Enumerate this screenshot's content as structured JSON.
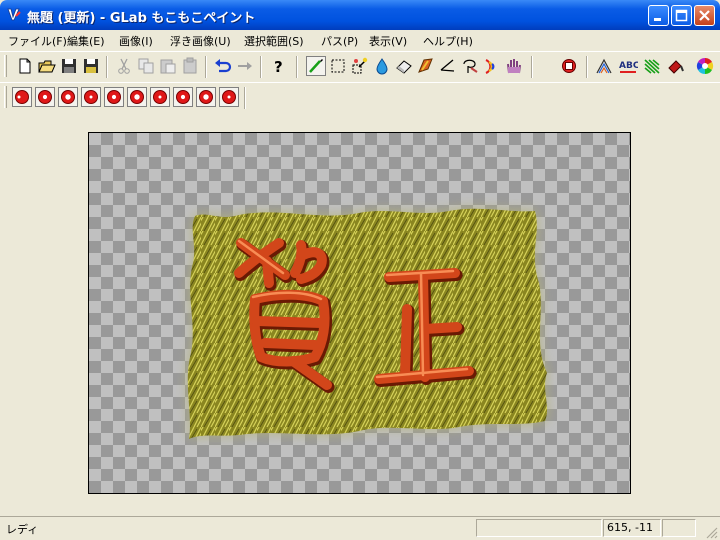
{
  "window": {
    "title": "無題 (更新) - GLab もこもこペイント",
    "controls": [
      "minimize-icon",
      "maximize-icon",
      "close-icon"
    ],
    "accent_color": "#0a5ce6"
  },
  "menu": {
    "items": [
      "ファイル(F)",
      "編集(E)",
      "画像(I)",
      "浮き画像(U)",
      "選択範囲(S)",
      "パス(P)",
      "表示(V)",
      "ヘルプ(H)"
    ]
  },
  "toolbar1": {
    "icons": [
      "new-file-icon",
      "open-folder-icon",
      "save-icon",
      "save-all-icon",
      "cut-icon",
      "copy-icon",
      "paste-icon",
      "paste-special-icon",
      "undo-icon",
      "redo-icon",
      "help-icon",
      "pen-tool-icon",
      "rect-select-icon",
      "magic-wand-icon",
      "dropper-icon",
      "eraser-icon",
      "brush-icon",
      "line-tool-icon",
      "lasso-icon",
      "rainbow-icon",
      "hand-icon",
      "filter-icon",
      "gradient-icon",
      "pattern-icon",
      "texture-icon",
      "fill-icon",
      "color-wheel-icon"
    ]
  },
  "toolbar2": {
    "icons": [
      "red-ball-1-icon",
      "red-ball-2-icon",
      "red-ball-3-icon",
      "red-ball-4-icon",
      "red-ball-5-icon",
      "red-ball-6-icon",
      "red-ball-7-icon",
      "red-ball-8-icon",
      "red-ball-9-icon",
      "red-ball-10-icon"
    ]
  },
  "canvas": {
    "artwork_text": "賀正",
    "paper_color": "#8c8a1e",
    "stroke_color": "#d24a14"
  },
  "status": {
    "text": "レディ",
    "coords": "615, -11"
  }
}
